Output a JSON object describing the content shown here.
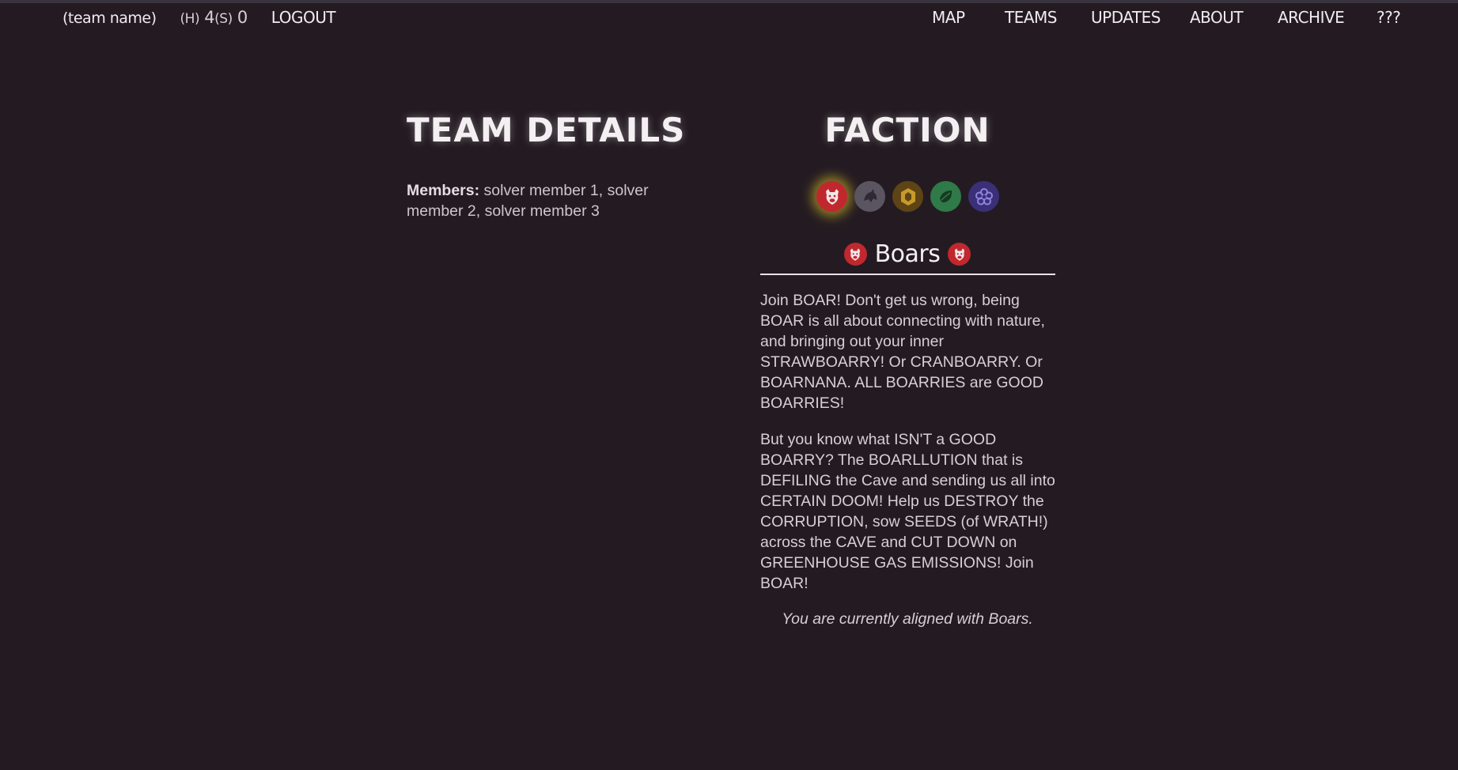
{
  "nav": {
    "team_name": "(team name)",
    "score_h_label": "(H)",
    "score_h_value": "4",
    "score_s_label": "(S)",
    "score_s_value": "0",
    "logout": "LOGOUT",
    "links": [
      "MAP",
      "TEAMS",
      "UPDATES",
      "ABOUT",
      "ARCHIVE",
      "???"
    ]
  },
  "team_details": {
    "heading": "TEAM DETAILS",
    "members_label": "Members:",
    "members_value": "solver member 1, solver member 2, solver member 3"
  },
  "faction": {
    "heading": "FACTION",
    "options": [
      {
        "icon": "boar-icon",
        "color": "#c0282e",
        "selected": true
      },
      {
        "icon": "beast-icon",
        "color": "#5a5560",
        "selected": false
      },
      {
        "icon": "hexagon-icon",
        "color": "#5e4415",
        "selected": false
      },
      {
        "icon": "leaf-icon",
        "color": "#2f7a48",
        "selected": false
      },
      {
        "icon": "flower-icon",
        "color": "#3b2f78",
        "selected": false
      }
    ],
    "selected_name": "Boars",
    "description": [
      "Join BOAR! Don't get us wrong, being BOAR is all about connecting with nature, and bringing out your inner STRAWBOARRY! Or CRANBOARRY. Or BOARNANA. ALL BOARRIES are GOOD BOARRIES!",
      "But you know what ISN'T a GOOD BOARRY? The BOARLLUTION that is DEFILING the Cave and sending us all into CERTAIN DOOM! Help us DESTROY the CORRUPTION, sow SEEDS (of WRATH!) across the CAVE and CUT DOWN on GREENHOUSE GAS EMISSIONS! Join BOAR!"
    ],
    "aligned_text": "You are currently aligned with Boars."
  }
}
